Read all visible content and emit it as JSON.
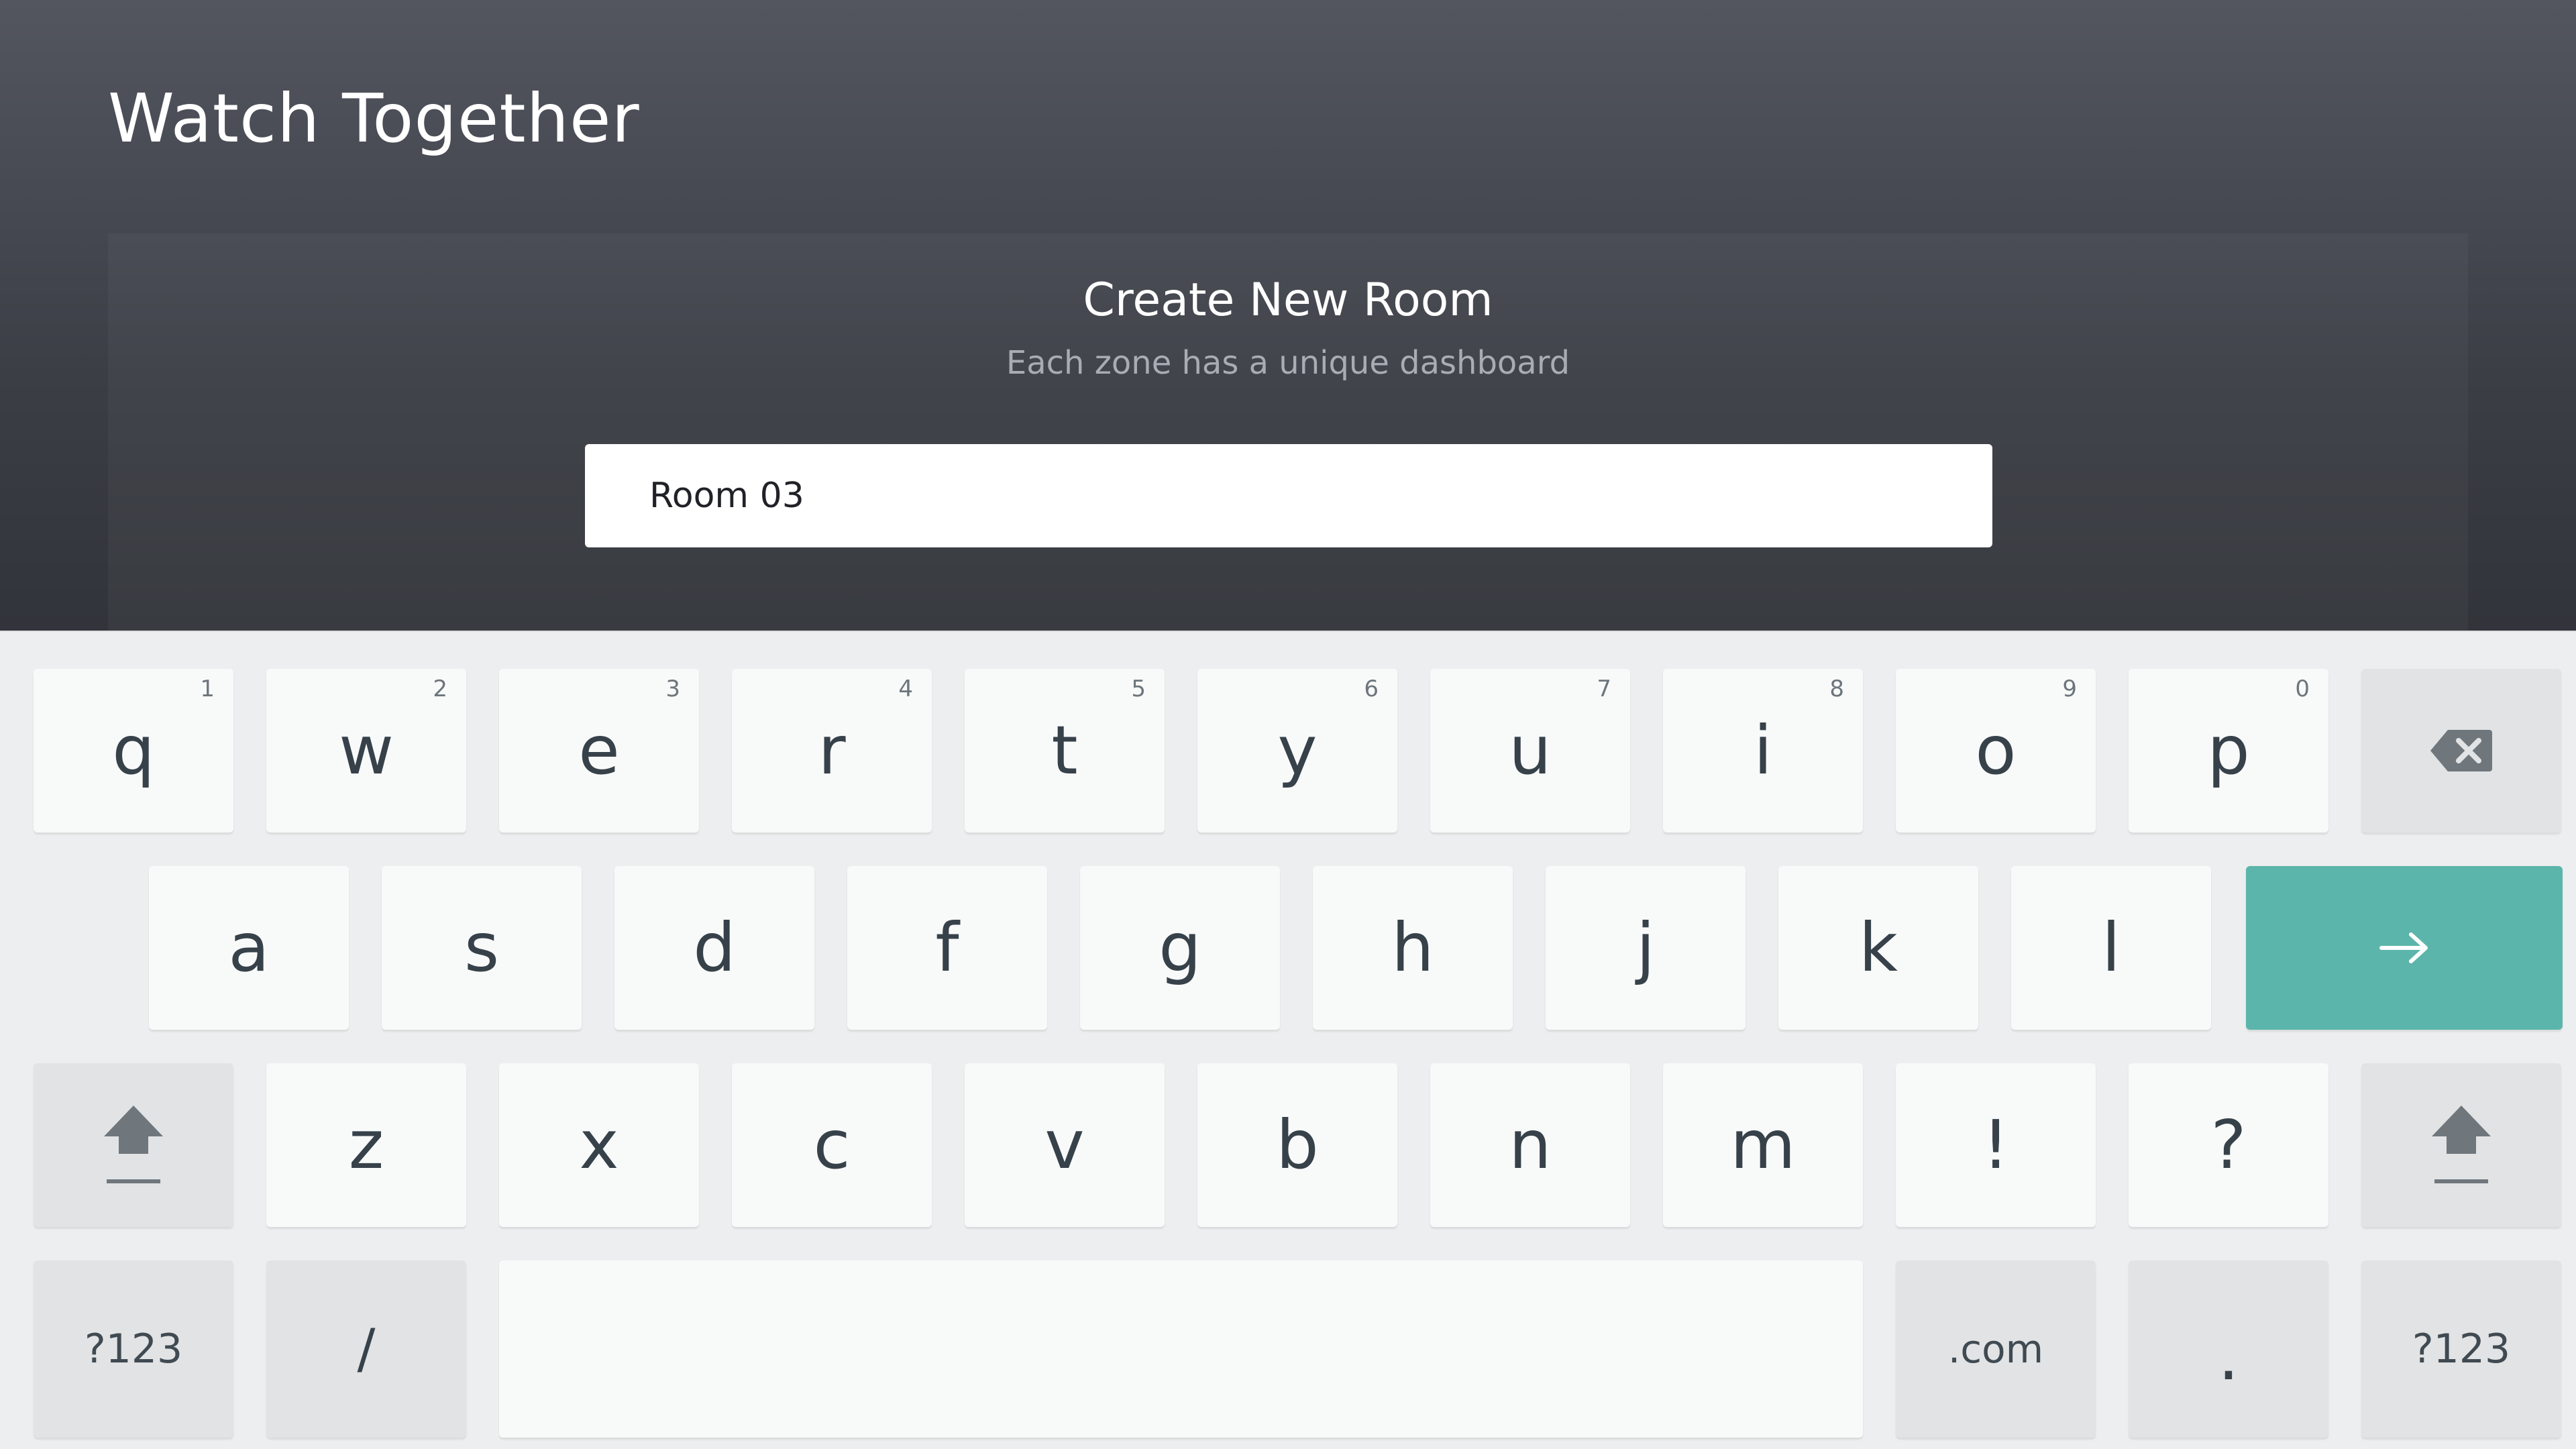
{
  "app": {
    "title": "Watch Together"
  },
  "dialog": {
    "title": "Create New Room",
    "subtitle": "Each zone has a unique dashboard",
    "room_name_value": "Room 03"
  },
  "keyboard": {
    "row1": [
      {
        "char": "q",
        "hint": "1"
      },
      {
        "char": "w",
        "hint": "2"
      },
      {
        "char": "e",
        "hint": "3"
      },
      {
        "char": "r",
        "hint": "4"
      },
      {
        "char": "t",
        "hint": "5"
      },
      {
        "char": "y",
        "hint": "6"
      },
      {
        "char": "u",
        "hint": "7"
      },
      {
        "char": "i",
        "hint": "8"
      },
      {
        "char": "o",
        "hint": "9"
      },
      {
        "char": "p",
        "hint": "0"
      }
    ],
    "row2": [
      "a",
      "s",
      "d",
      "f",
      "g",
      "h",
      "j",
      "k",
      "l"
    ],
    "row3": [
      "z",
      "x",
      "c",
      "v",
      "b",
      "n",
      "m",
      "!",
      "?"
    ],
    "symbols_label": "?123",
    "slash_label": "/",
    "com_label": ".com",
    "period_label": ".",
    "icons": {
      "backspace": "backspace-icon",
      "enter": "arrow-right-icon",
      "shift": "shift-icon"
    },
    "colors": {
      "enter_key": "#5cb5ab",
      "key": "#f8f9f9",
      "function_key": "#e1e3e4"
    }
  }
}
